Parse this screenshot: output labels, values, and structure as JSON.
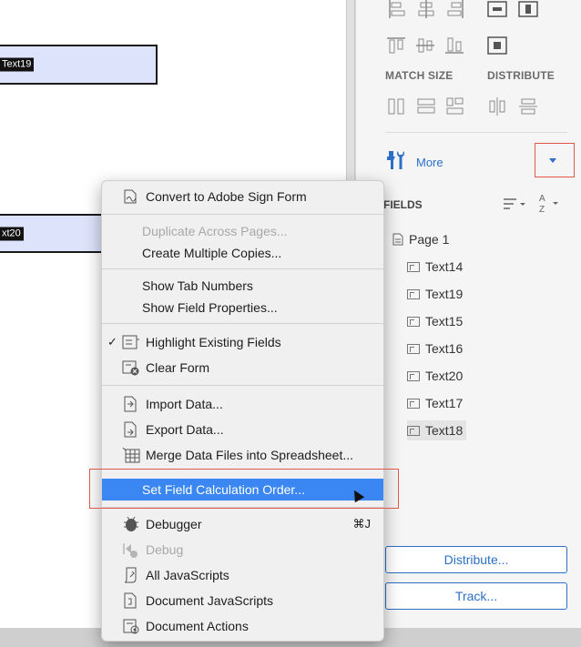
{
  "canvas": {
    "fields": [
      {
        "label": "Text19"
      },
      {
        "label": "xt20"
      }
    ]
  },
  "panel": {
    "match_size_label": "MATCH SIZE",
    "distribute_label": "DISTRIBUTE",
    "more_label": "More",
    "fields_title": "FIELDS",
    "page_label": "Page 1",
    "tree_items": [
      "Text14",
      "Text19",
      "Text15",
      "Text16",
      "Text20",
      "Text17",
      "Text18"
    ],
    "distribute_button": "Distribute...",
    "track_button": "Track..."
  },
  "menu": {
    "convert": "Convert to Adobe Sign Form",
    "duplicate": "Duplicate Across Pages...",
    "multiple": "Create Multiple Copies...",
    "tab_numbers": "Show Tab Numbers",
    "field_props": "Show Field Properties...",
    "highlight": "Highlight Existing Fields",
    "highlight_check": "✓",
    "clear": "Clear Form",
    "import": "Import Data...",
    "export": "Export Data...",
    "merge": "Merge Data Files into Spreadsheet...",
    "calc_order": "Set Field Calculation Order...",
    "debugger": "Debugger",
    "debugger_shortcut": "⌘J",
    "debug": "Debug",
    "all_js": "All JavaScripts",
    "doc_js": "Document JavaScripts",
    "doc_actions": "Document Actions"
  },
  "colors": {
    "accent": "#2b6fc9",
    "highlight": "#3a87f4",
    "callout": "#e0584a",
    "field_fill": "#dde3fb"
  }
}
